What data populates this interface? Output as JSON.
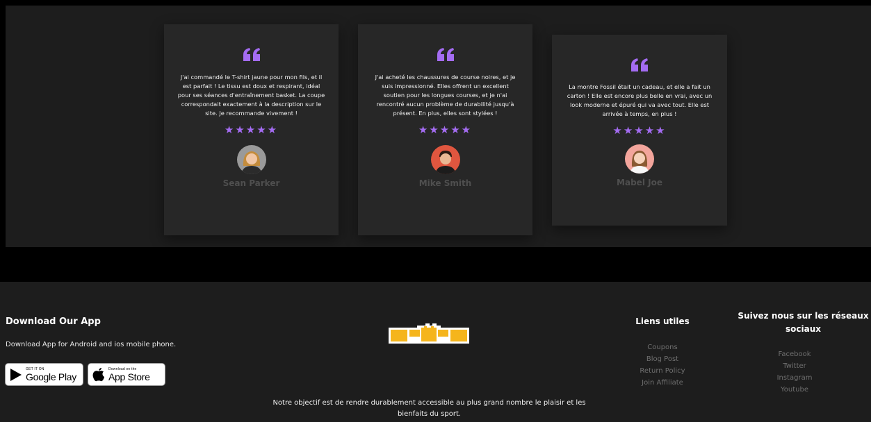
{
  "testimonials": [
    {
      "text": "J'ai commandé le T-shirt jaune pour mon fils, et il est parfait ! Le tissu est doux et respirant, idéal pour ses séances d'entraînement basket. La coupe correspondait exactement à la description sur le site. Je recommande vivement !",
      "stars": "★★★★★",
      "rating": 5,
      "name": "Sean Parker"
    },
    {
      "text": "J'ai acheté les chaussures de course noires, et je suis impressionné. Elles offrent un excellent soutien pour les longues courses, et je n'ai rencontré aucun problème de durabilité jusqu'à présent. En plus, elles sont stylées !",
      "stars": "★★★★★",
      "rating": 5,
      "name": "Mike Smith"
    },
    {
      "text": "La montre Fossil était un cadeau, et elle a fait un carton ! Elle est encore plus belle en vrai, avec un look moderne et épuré qui va avec tout. Elle est arrivée à temps, en plus !",
      "stars": "★★★★★",
      "rating": 5,
      "name": "Mabel Joe"
    }
  ],
  "footer": {
    "app_title": "Download Our App",
    "app_desc": "Download App for Android and ios mobile phone.",
    "google_small": "GET IT ON",
    "google_big": "Google Play",
    "apple_small": "Download on the",
    "apple_big": "App Store",
    "mission": "Notre objectif est de rendre durablement accessible au plus grand nombre le plaisir et les bienfaits du sport.",
    "links_title": "Liens utiles",
    "links": [
      "Coupons",
      "Blog Post",
      "Return Policy",
      "Join Affiliate"
    ],
    "social_title": "Suivez nous sur les réseaux sociaux",
    "social": [
      "Facebook",
      "Twitter",
      "Instagram",
      "Youtube"
    ]
  },
  "colors": {
    "accent": "#a46cf2",
    "logo": "#f5b51c",
    "card": "#272727",
    "section": "#1d1d1d"
  },
  "icons": [
    "quote-icon",
    "star-icon",
    "google-play-icon",
    "apple-icon",
    "brand-logo"
  ]
}
